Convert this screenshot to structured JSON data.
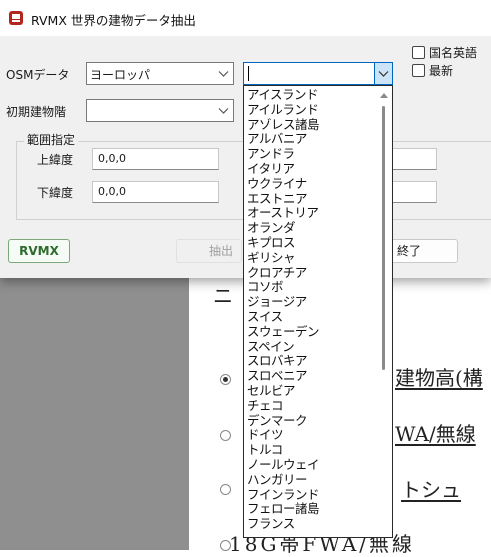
{
  "window": {
    "title": "RVMX 世界の建物データ抽出"
  },
  "form": {
    "osm_label": "OSMデータ",
    "osm_value": "ヨーロッパ",
    "country_value": "",
    "initial_building_label": "初期建物階",
    "initial_building_value": "",
    "checkbox_country_en": "国名英語",
    "checkbox_latest": "最新",
    "range_group_label": "範囲指定",
    "upper_lat_label": "上緯度",
    "upper_lat_value": "0,0,0",
    "lower_lat_label": "下緯度",
    "lower_lat_value": "0,0,0",
    "upper_lon_value": "",
    "lower_lon_value": ""
  },
  "buttons": {
    "rvmx": "RVMX",
    "extract": "抽出",
    "close": "終了"
  },
  "dropdown": {
    "items": [
      "アイスランド",
      "アイルランド",
      "アゾレス諸島",
      "アルバニア",
      "アンドラ",
      "イタリア",
      "ウクライナ",
      "エストニア",
      "オーストリア",
      "オランダ",
      "キプロス",
      "ギリシャ",
      "クロアチア",
      "コソボ",
      "ジョージア",
      "スイス",
      "スウェーデン",
      "スペイン",
      "スロバキア",
      "スロベニア",
      "セルビア",
      "チェコ",
      "デンマーク",
      "ドイツ",
      "トルコ",
      "ノールウェイ",
      "ハンガリー",
      "フインランド",
      "フェロー諸島",
      "フランス"
    ]
  },
  "background_doc": {
    "line1": "ニ",
    "line2": "建物高(構",
    "line3": "WA/無線",
    "line4": "トシュ",
    "line5": "18G帯FWA/無線"
  }
}
